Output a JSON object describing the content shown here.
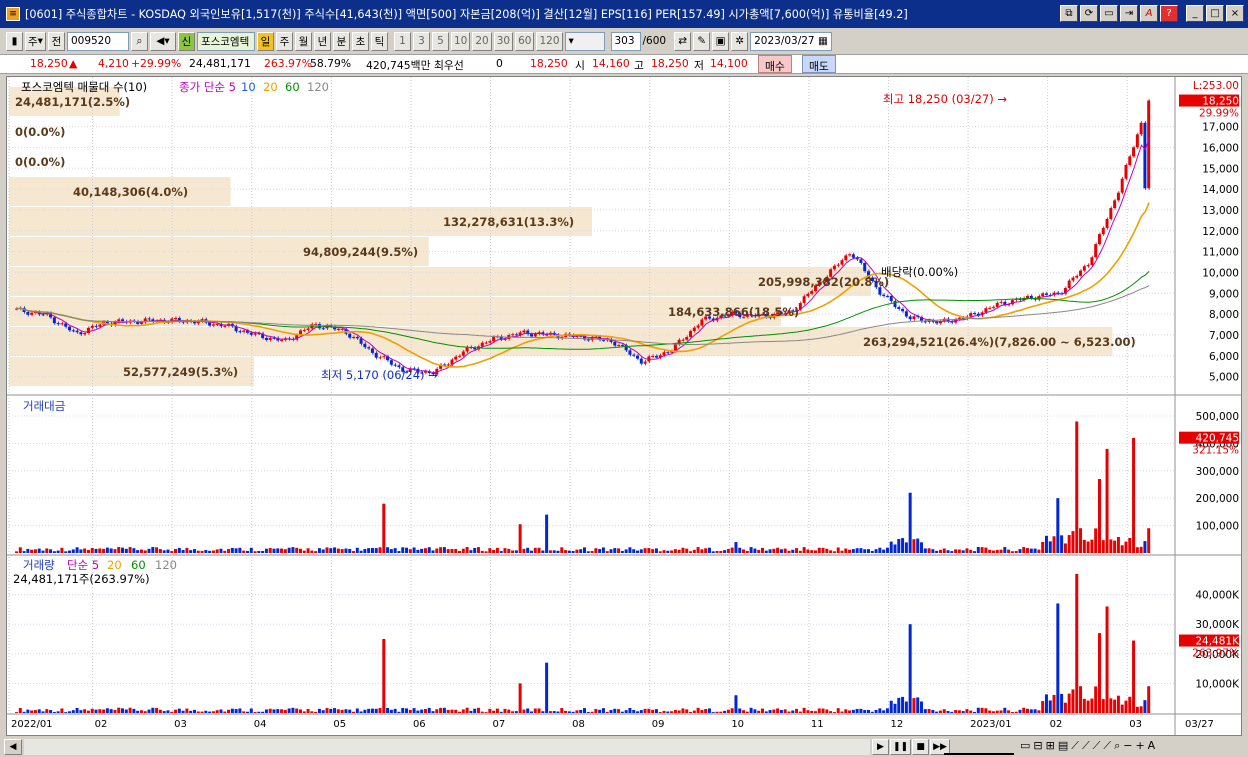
{
  "title": "[0601] 주식종합차트 - KOSDAQ 외국인보유[1,517(천)] 주식수[41,643(천)] 액면[500] 자본금[208(억)] 결산[12월] EPS[116] PER[157.49] 시가총액[7,600(억)] 유통비율[49.2]",
  "window_buttons": [
    "⧉",
    "⟳",
    "▭",
    "⇥",
    "A",
    "?",
    "_",
    "□",
    "×"
  ],
  "toolbar": {
    "market_select": "주",
    "jeon": "전",
    "code": "009520",
    "stock_name": "포스코엠텍",
    "periods": [
      "일",
      "주",
      "월",
      "년",
      "분",
      "초",
      "틱"
    ],
    "active_period": "일",
    "intervals": [
      "1",
      "3",
      "5",
      "10",
      "20",
      "30",
      "60",
      "120"
    ],
    "count": "303",
    "count_total": "/600",
    "date": "2023/03/27"
  },
  "quote": {
    "price": "18,250",
    "change": "4,210",
    "change_rate": "+29.99%",
    "volume": "24,481,171",
    "vol_ratio": "263.97%",
    "turnover": "58.79%",
    "amount": "420,745백만",
    "best_bid_label": "최우선",
    "best_bid": "0",
    "price2": "18,250",
    "open_label": "시",
    "open": "14,160",
    "high_label": "고",
    "high": "18,250",
    "low_label": "저",
    "low": "14,100",
    "buy": "매수",
    "sell": "매도"
  },
  "chart_data": [
    {
      "type": "line",
      "title": "포스코엠텍 매물대 수(10)",
      "legend": [
        "종가 단순 5",
        "10",
        "20",
        "60",
        "120"
      ],
      "y_ticks": [
        5000,
        6000,
        7000,
        8000,
        9000,
        10000,
        11000,
        12000,
        13000,
        14000,
        15000,
        16000,
        17000
      ],
      "ylim": [
        4500,
        18900
      ],
      "x_labels": [
        "2022/01",
        "02",
        "03",
        "04",
        "05",
        "06",
        "07",
        "08",
        "09",
        "10",
        "11",
        "12",
        "2023/01",
        "02",
        "03"
      ],
      "current_price": "18,250",
      "current_pct": "29.99%",
      "top_label": "L:253.00",
      "series": [
        {
          "name": "종가",
          "values": [
            8200,
            7950,
            7050,
            7600,
            7650,
            7700,
            7650,
            7450,
            7000,
            6700,
            7500,
            7200,
            6100,
            5300,
            5200,
            6200,
            6800,
            7100,
            7000,
            6900,
            6700,
            5700,
            6300,
            7700,
            8000,
            7900,
            8100,
            9600,
            11000,
            9000,
            7800,
            7600,
            7900,
            8500,
            8800,
            9000,
            10500,
            14000,
            18250
          ]
        }
      ],
      "annotations": [
        "최고 18,250 (03/27)",
        "최저 5,170 (06/24)",
        "배당락(0.00%)"
      ],
      "volume_profile": [
        "24,481,171(2.5%)",
        "0(0.0%)",
        "0(0.0%)",
        "40,148,306(4.0%)",
        "132,278,631(13.3%)",
        "94,809,244(9.5%)",
        "205,998,382(20.8%)",
        "184,633,866(18.5%)",
        "263,294,521(26.4%)(7,826.00 ~ 6,523.00)",
        "52,577,249(5.3%)"
      ]
    },
    {
      "type": "bar",
      "title": "거래대금",
      "y_ticks": [
        "100,000",
        "200,000",
        "300,000",
        "400,000",
        "500,000"
      ],
      "ylim": [
        0,
        540000
      ],
      "current_value": "420,745",
      "current_pct": "321.15%"
    },
    {
      "type": "bar",
      "title": "거래량",
      "legend": [
        "단순 5",
        "20",
        "60",
        "120"
      ],
      "subtitle": "24,481,171주(263.97%)",
      "y_ticks": [
        "10,000K",
        "20,000K",
        "30,000K",
        "40,000K"
      ],
      "ylim": [
        0,
        50000
      ],
      "current_value": "24,481K",
      "current_pct": "263.97%",
      "last_date": "03/27"
    }
  ],
  "colors": {
    "up": "#e60000",
    "down": "#0026d6",
    "ma5": "#c000c0",
    "ma20": "#f0a000",
    "ma60": "#009000",
    "ma120": "#888888",
    "title_bar": "#0b2f8a"
  }
}
